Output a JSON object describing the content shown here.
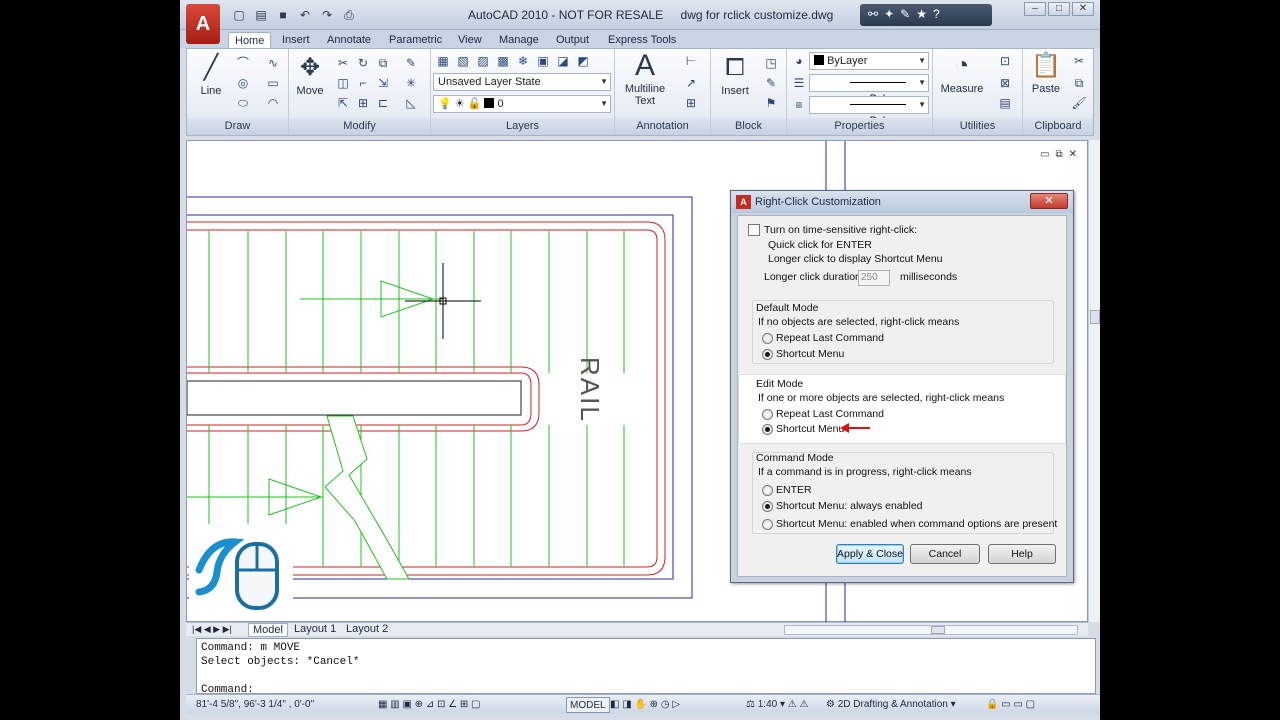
{
  "title": {
    "app": "AutoCAD 2010 - NOT FOR RESALE",
    "file": "dwg for rclick customize.dwg"
  },
  "ribbon_tabs": [
    "Home",
    "Insert",
    "Annotate",
    "Parametric",
    "View",
    "Manage",
    "Output",
    "Express Tools"
  ],
  "ribbon": {
    "draw": {
      "line": "Line",
      "title": "Draw"
    },
    "modify": {
      "move": "Move",
      "title": "Modify"
    },
    "layers": {
      "state": "Unsaved Layer State",
      "layer": "0",
      "title": "Layers"
    },
    "annotation": {
      "mtext1": "Multiline",
      "mtext2": "Text",
      "title": "Annotation"
    },
    "block": {
      "insert": "Insert",
      "title": "Block"
    },
    "properties": {
      "color": "ByLayer",
      "linetype": "ByLayer",
      "lineweight": "ByLayer",
      "title": "Properties"
    },
    "utilities": {
      "measure": "Measure",
      "title": "Utilities"
    },
    "clipboard": {
      "paste": "Paste",
      "title": "Clipboard"
    }
  },
  "drawing": {
    "rail_label": "RAIL"
  },
  "layout_tabs": [
    "Model",
    "Layout 1",
    "Layout 2"
  ],
  "command_lines": [
    "Command: m MOVE",
    "Select objects: *Cancel*",
    "",
    "Command:"
  ],
  "status": {
    "coords": "81'-4 5/8\",  96'-3 1/4\" , 0'-0\"",
    "model": "MODEL",
    "scale": "1:40",
    "workspace": "2D Drafting & Annotation"
  },
  "dialog": {
    "title": "Right-Click Customization",
    "close": "✕",
    "time_sensitive": {
      "label": "Turn on time-sensitive right-click:",
      "checked": false,
      "quick": "Quick click for ENTER",
      "longer": "Longer click to display Shortcut Menu",
      "duration_label": "Longer click duration:",
      "duration": "250",
      "unit": "milliseconds"
    },
    "default_mode": {
      "title": "Default Mode",
      "desc": "If no objects are selected, right-click means",
      "options": [
        "Repeat Last Command",
        "Shortcut Menu"
      ],
      "selected": 1
    },
    "edit_mode": {
      "title": "Edit Mode",
      "desc": "If one or more objects are selected, right-click means",
      "options": [
        "Repeat Last Command",
        "Shortcut Menu"
      ],
      "selected": 1
    },
    "command_mode": {
      "title": "Command Mode",
      "desc": "If a command is in progress, right-click means",
      "options": [
        "ENTER",
        "Shortcut Menu: always enabled",
        "Shortcut Menu: enabled when command options are present"
      ],
      "selected": 1
    },
    "buttons": {
      "apply": "Apply & Close",
      "cancel": "Cancel",
      "help": "Help"
    },
    "accent": "#3c7fb1"
  },
  "annotation_arrow_color": "#e01010"
}
